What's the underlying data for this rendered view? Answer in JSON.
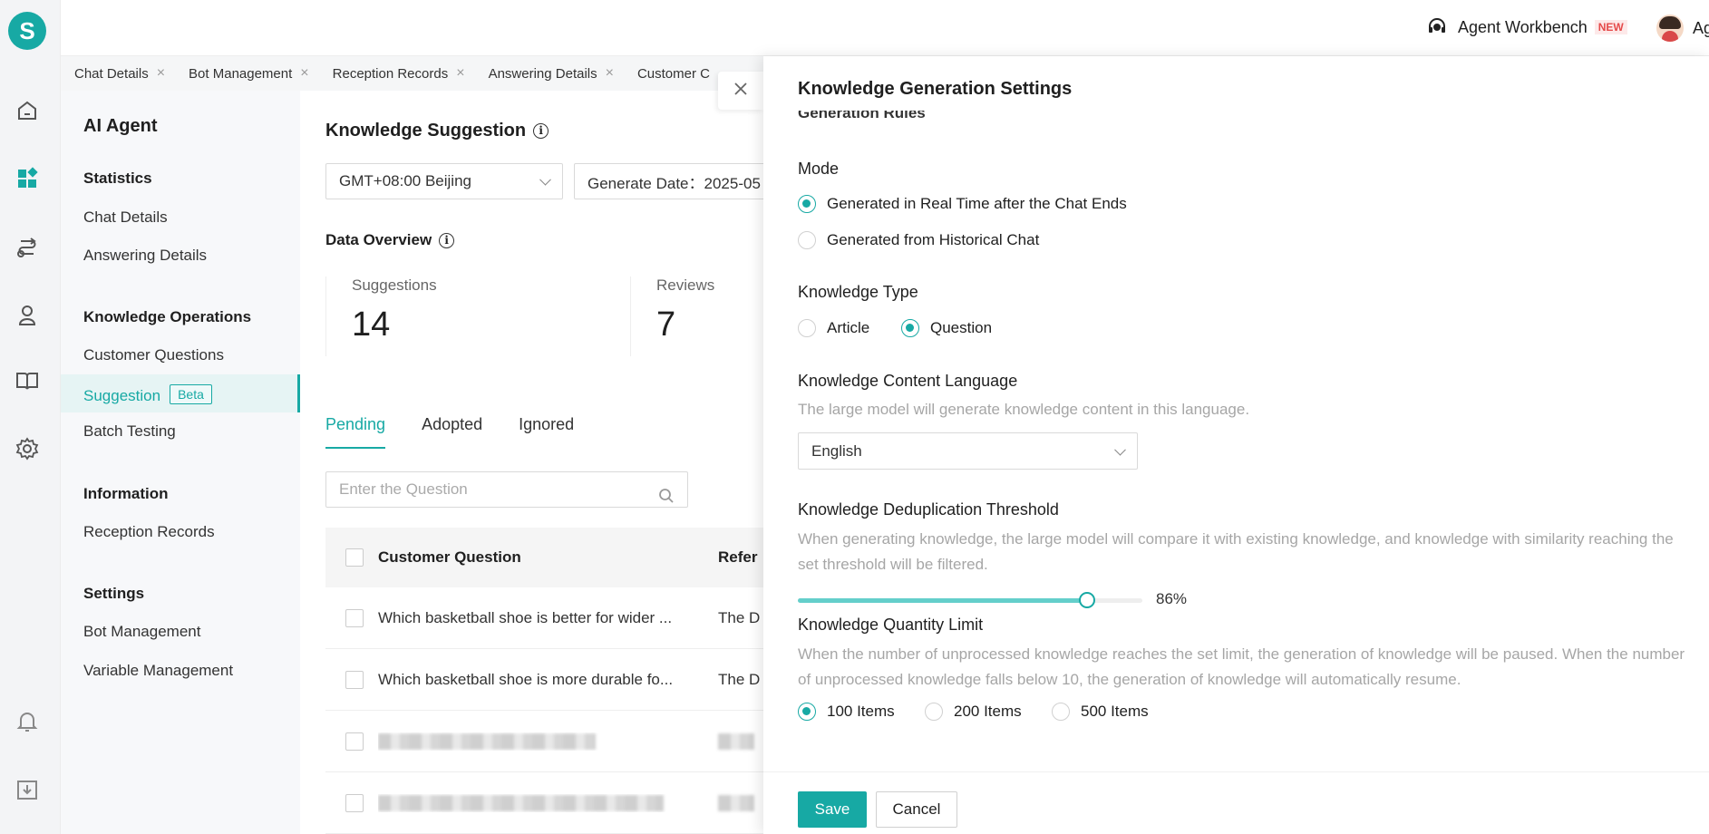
{
  "topbar": {
    "workbench": "Agent Workbench",
    "new_badge": "NEW",
    "user": "Agent"
  },
  "tabs": [
    "Chat Details",
    "Bot Management",
    "Reception Records",
    "Answering Details",
    "Customer C"
  ],
  "subnav": {
    "title": "AI Agent",
    "statistics": {
      "heading": "Statistics",
      "items": [
        "Chat Details",
        "Answering Details"
      ]
    },
    "knowledge_ops": {
      "heading": "Knowledge Operations",
      "items": [
        "Customer Questions",
        "Suggestion",
        "Batch Testing"
      ],
      "beta": "Beta"
    },
    "information": {
      "heading": "Information",
      "items": [
        "Reception Records"
      ]
    },
    "settings": {
      "heading": "Settings",
      "items": [
        "Bot Management",
        "Variable Management"
      ]
    }
  },
  "main": {
    "title": "Knowledge Suggestion",
    "timezone": "GMT+08:00 Beijing",
    "generate_date": "Generate Date：2025-05",
    "overview_title": "Data Overview",
    "stats": [
      {
        "label": "Suggestions",
        "value": "14"
      },
      {
        "label": "Reviews",
        "value": "7"
      }
    ],
    "list_tabs": [
      "Pending",
      "Adopted",
      "Ignored"
    ],
    "search_placeholder": "Enter the Question",
    "columns": [
      "Customer Question",
      "Refer"
    ],
    "rows": [
      {
        "question": "Which basketball shoe is better for wider ...",
        "ref": "The D"
      },
      {
        "question": "Which basketball shoe is more durable fo...",
        "ref": "The D"
      }
    ]
  },
  "drawer": {
    "title": "Knowledge Generation Settings",
    "section_cut": "Generation Rules",
    "mode": {
      "label": "Mode",
      "options": [
        "Generated in Real Time after the Chat Ends",
        "Generated from Historical Chat"
      ],
      "selected": 0
    },
    "type": {
      "label": "Knowledge Type",
      "options": [
        "Article",
        "Question"
      ],
      "selected": 1
    },
    "language": {
      "label": "Knowledge Content Language",
      "help": "The large model will generate knowledge content in this language.",
      "value": "English"
    },
    "dedup": {
      "label": "Knowledge Deduplication Threshold",
      "help": "When generating knowledge, the large model will compare it with existing knowledge, and knowledge with similarity reaching the set threshold will be filtered.",
      "value_text": "86%",
      "value": 0.86
    },
    "quantity": {
      "label": "Knowledge Quantity Limit",
      "help": "When the number of unprocessed knowledge reaches the set limit, the generation of knowledge will be paused. When the number of unprocessed knowledge falls below 10, the generation of knowledge will automatically resume.",
      "options": [
        "100 Items",
        "200 Items",
        "500 Items"
      ],
      "selected": 0
    },
    "save": "Save",
    "cancel": "Cancel"
  },
  "colors": {
    "accent": "#17a9a4",
    "accent_light": "#64cfcb"
  }
}
